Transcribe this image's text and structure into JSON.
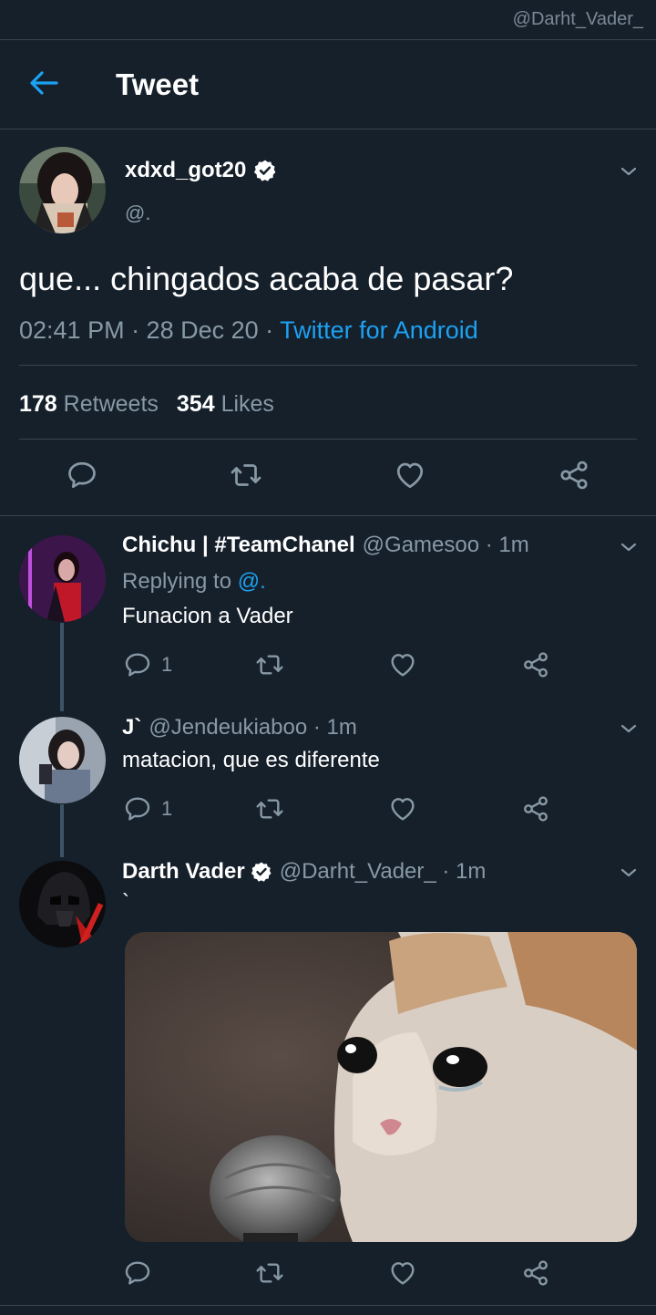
{
  "watermark": "@Darht_Vader_",
  "header": {
    "title": "Tweet"
  },
  "main_tweet": {
    "name": "xdxd_got20",
    "handle": "@.",
    "text": "que... chingados acaba de pasar?",
    "time": "02:41 PM · 28 Dec 20 · ",
    "source": "Twitter for Android",
    "retweets_count": "178",
    "retweets_label": "Retweets",
    "likes_count": "354",
    "likes_label": "Likes"
  },
  "replies": [
    {
      "name": "Chichu | #TeamChanel",
      "meta": "@Gamesoo · 1m",
      "replying_label": "Replying to ",
      "replying_to": "@.",
      "text": "Funacion a Vader",
      "reply_count": "1"
    },
    {
      "name": "J`",
      "meta": "@Jendeukiaboo · 1m",
      "text": "matacion, que es diferente",
      "reply_count": "1"
    },
    {
      "name": "Darth Vader",
      "meta": "@Darht_Vader_ · 1m",
      "text": "`"
    }
  ],
  "colors": {
    "background": "#15202b",
    "accent": "#1da1f2",
    "muted": "#8899a6",
    "divider": "#38444d"
  },
  "icons": [
    "back-arrow-icon",
    "verified-badge-icon",
    "chevron-down-icon",
    "reply-icon",
    "retweet-icon",
    "like-icon",
    "share-icon"
  ]
}
